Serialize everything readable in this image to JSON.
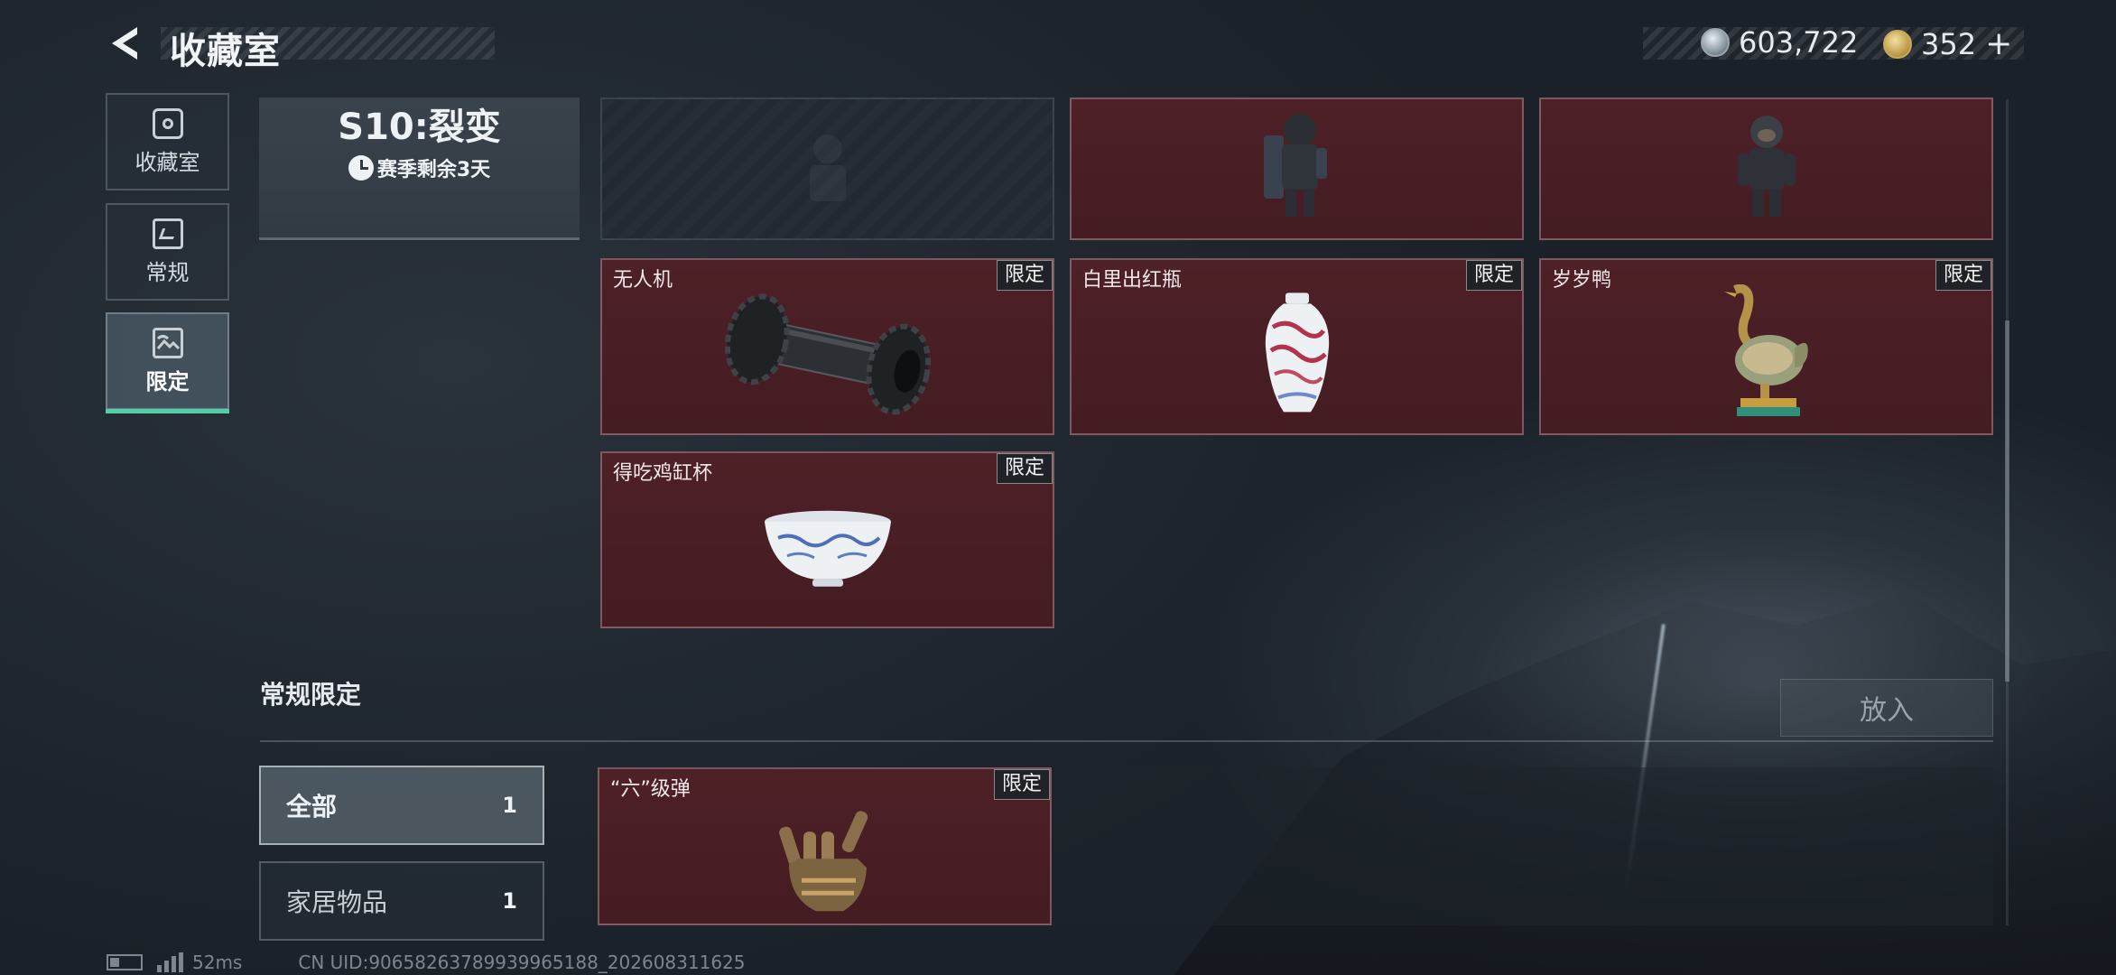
{
  "header": {
    "title": "收藏室",
    "currency_silver": "603,722",
    "currency_gold": "352",
    "plus": "+"
  },
  "sidebar": {
    "tabs": [
      {
        "label": "收藏室",
        "icon": "safe-icon"
      },
      {
        "label": "常规",
        "icon": "document-icon"
      },
      {
        "label": "限定",
        "icon": "picture-icon",
        "active": true
      }
    ]
  },
  "season": {
    "title": "S10:裂变",
    "remaining": "赛季剩余3天"
  },
  "items": [
    {
      "name": "",
      "badge": "",
      "art": "locked-figure"
    },
    {
      "name": "",
      "badge": "",
      "art": "armored-soldier-figure"
    },
    {
      "name": "",
      "badge": "",
      "art": "soldier-figure"
    },
    {
      "name": "无人机",
      "badge": "限定",
      "art": "drone-part"
    },
    {
      "name": "白里出红瓶",
      "badge": "限定",
      "art": "porcelain-vase"
    },
    {
      "name": "岁岁鸭",
      "badge": "限定",
      "art": "bronze-duck"
    },
    {
      "name": "得吃鸡缸杯",
      "badge": "限定",
      "art": "porcelain-cup"
    }
  ],
  "section": {
    "title": "常规限定",
    "place_button": "放入"
  },
  "filters": [
    {
      "label": "全部",
      "count": "1"
    },
    {
      "label": "家居物品",
      "count": "1"
    }
  ],
  "lower_items": [
    {
      "name": "“六”级弹",
      "badge": "限定",
      "art": "bullet-hand"
    }
  ],
  "footer": {
    "ping": "52ms",
    "uid": "CN UID:90658263789939965188_202608311625"
  },
  "colors": {
    "accent": "#4fd1a5",
    "card": "#4a1e24",
    "background": "#222930"
  }
}
